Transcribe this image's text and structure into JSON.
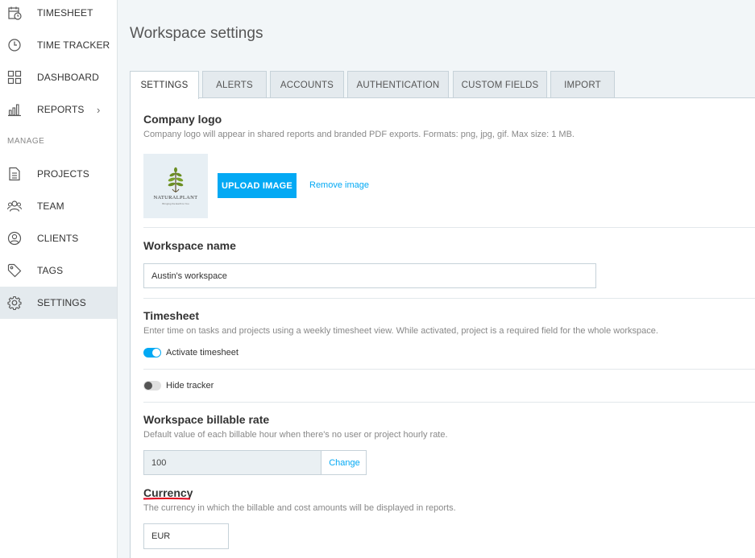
{
  "sidebar": {
    "items": [
      {
        "label": "TIMESHEET",
        "icon": "timesheet-icon"
      },
      {
        "label": "TIME TRACKER",
        "icon": "clock-icon"
      },
      {
        "label": "DASHBOARD",
        "icon": "dashboard-icon"
      },
      {
        "label": "REPORTS",
        "icon": "bar-chart-icon",
        "chevron": "›"
      },
      {
        "label": "PROJECTS",
        "icon": "document-icon"
      },
      {
        "label": "TEAM",
        "icon": "team-icon"
      },
      {
        "label": "CLIENTS",
        "icon": "user-circle-icon"
      },
      {
        "label": "TAGS",
        "icon": "tag-icon"
      },
      {
        "label": "SETTINGS",
        "icon": "gear-icon",
        "active": true
      }
    ],
    "section_label": "MANAGE"
  },
  "page": {
    "title": "Workspace settings"
  },
  "tabs": [
    {
      "label": "SETTINGS",
      "active": true
    },
    {
      "label": "ALERTS"
    },
    {
      "label": "ACCOUNTS"
    },
    {
      "label": "AUTHENTICATION"
    },
    {
      "label": "CUSTOM FIELDS"
    },
    {
      "label": "IMPORT"
    }
  ],
  "company_logo": {
    "heading": "Company logo",
    "description": "Company logo will appear in shared reports and branded PDF exports. Formats: png, jpg, gif. Max size: 1 MB.",
    "logo_text": "NATURALPLANT",
    "logo_subtext": "Bringing the Earth to You",
    "upload_label": "UPLOAD IMAGE",
    "remove_label": "Remove image"
  },
  "workspace_name": {
    "heading": "Workspace name",
    "value": "Austin's workspace"
  },
  "timesheet": {
    "heading": "Timesheet",
    "description": "Enter time on tasks and projects using a weekly timesheet view. While activated, project is a required field for the whole workspace.",
    "activate_label": "Activate timesheet",
    "activate_on": true,
    "hide_tracker_label": "Hide tracker",
    "hide_tracker_on": false
  },
  "billable_rate": {
    "heading": "Workspace billable rate",
    "description": "Default value of each billable hour when there's no user or project hourly rate.",
    "value": "100",
    "change_label": "Change"
  },
  "currency": {
    "heading": "Currency",
    "description": "The currency in which the billable and cost amounts will be displayed in reports.",
    "value": "EUR"
  },
  "colors": {
    "accent": "#03a9f4",
    "sidebar_active": "#e4eaee",
    "underline": "#e0001a"
  }
}
